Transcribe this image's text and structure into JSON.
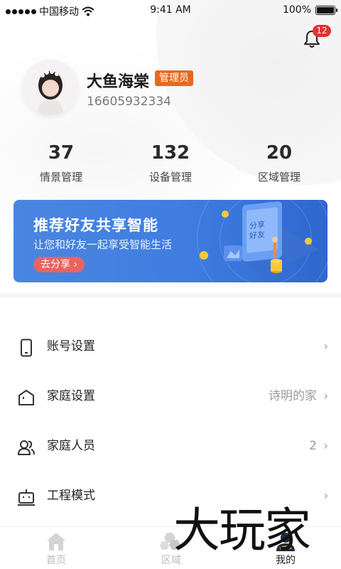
{
  "status_bar": {
    "carrier": "中国移动",
    "time": "9:41 AM",
    "battery": "100%"
  },
  "notification": {
    "icon": "bell-icon",
    "badge_count": "12"
  },
  "profile": {
    "name": "大鱼海棠",
    "role": "管理员",
    "phone": "16605932334"
  },
  "stats": [
    {
      "value": "37",
      "label": "情景管理"
    },
    {
      "value": "132",
      "label": "设备管理"
    },
    {
      "value": "20",
      "label": "区域管理"
    }
  ],
  "banner": {
    "title": "推荐好友共享智能",
    "subtitle": "让您和好友一起享受智能生活",
    "button": "去分享",
    "phone_text": "分享\n好友"
  },
  "menu": [
    {
      "label": "账号设置",
      "value": "",
      "icon": "phone-icon"
    },
    {
      "label": "家庭设置",
      "value": "诗明的家",
      "icon": "home-icon"
    },
    {
      "label": "家庭人员",
      "value": "2",
      "icon": "users-icon"
    },
    {
      "label": "工程模式",
      "value": "",
      "icon": "robot-icon"
    }
  ],
  "tabs": [
    {
      "label": "首页",
      "icon": "home-tab-icon",
      "active": false
    },
    {
      "label": "区域",
      "icon": "hexagon-tab-icon",
      "active": false
    },
    {
      "label": "我的",
      "icon": "user-tab-icon",
      "active": true
    }
  ],
  "watermark": "大玩家",
  "colors": {
    "accent": "#e8681f",
    "badge": "#e03232",
    "banner": "#3f7de0"
  }
}
